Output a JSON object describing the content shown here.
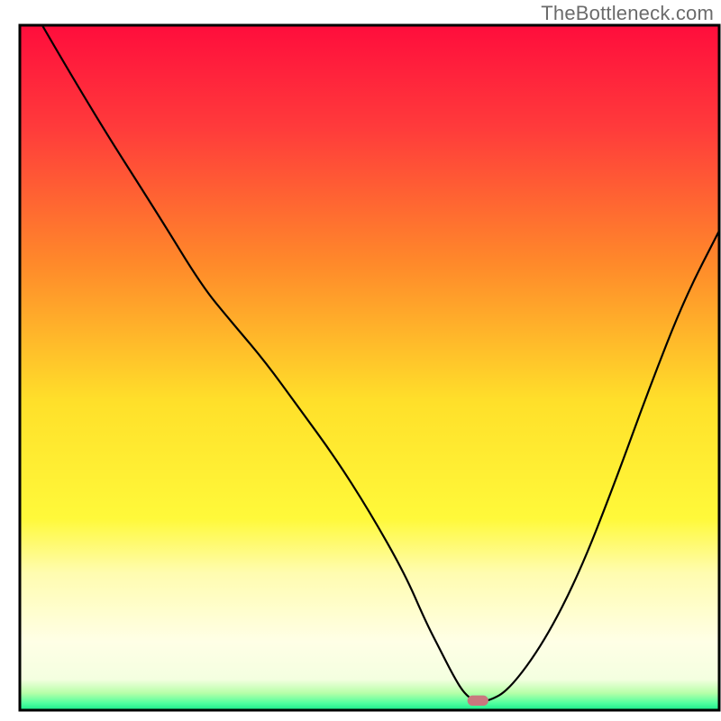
{
  "watermark": "TheBottleneck.com",
  "chart_data": {
    "type": "line",
    "title": "",
    "xlabel": "",
    "ylabel": "",
    "xlim": [
      0,
      100
    ],
    "ylim": [
      0,
      100
    ],
    "grid": false,
    "legend": false,
    "gradient_stops": [
      {
        "offset": 0.0,
        "color": "#ff0d3c"
      },
      {
        "offset": 0.15,
        "color": "#ff3b3b"
      },
      {
        "offset": 0.35,
        "color": "#ff8a2a"
      },
      {
        "offset": 0.55,
        "color": "#ffe02a"
      },
      {
        "offset": 0.72,
        "color": "#fff93a"
      },
      {
        "offset": 0.8,
        "color": "#fffcb0"
      },
      {
        "offset": 0.9,
        "color": "#ffffe6"
      },
      {
        "offset": 0.955,
        "color": "#f4ffe0"
      },
      {
        "offset": 0.975,
        "color": "#b7ffa8"
      },
      {
        "offset": 0.99,
        "color": "#4fff9f"
      },
      {
        "offset": 1.0,
        "color": "#17e88a"
      }
    ],
    "series": [
      {
        "name": "bottleneck-curve",
        "color": "#000000",
        "x": [
          3.2,
          10,
          20,
          26,
          30,
          35,
          40,
          45,
          50,
          55,
          58,
          60,
          62,
          63.5,
          65,
          67,
          70,
          75,
          80,
          85,
          90,
          95,
          100
        ],
        "y": [
          100,
          88,
          72,
          62,
          57,
          51,
          44,
          37,
          29,
          20,
          13,
          9,
          5,
          2.5,
          1.3,
          1.3,
          3,
          10,
          20,
          33,
          47,
          60,
          70
        ]
      }
    ],
    "marker": {
      "name": "optimal-point",
      "x": 65.5,
      "y": 1.4,
      "width": 3.0,
      "height": 1.5,
      "color": "#c9777e"
    },
    "axes": {
      "border_color": "#000000",
      "border_width": 3
    }
  }
}
